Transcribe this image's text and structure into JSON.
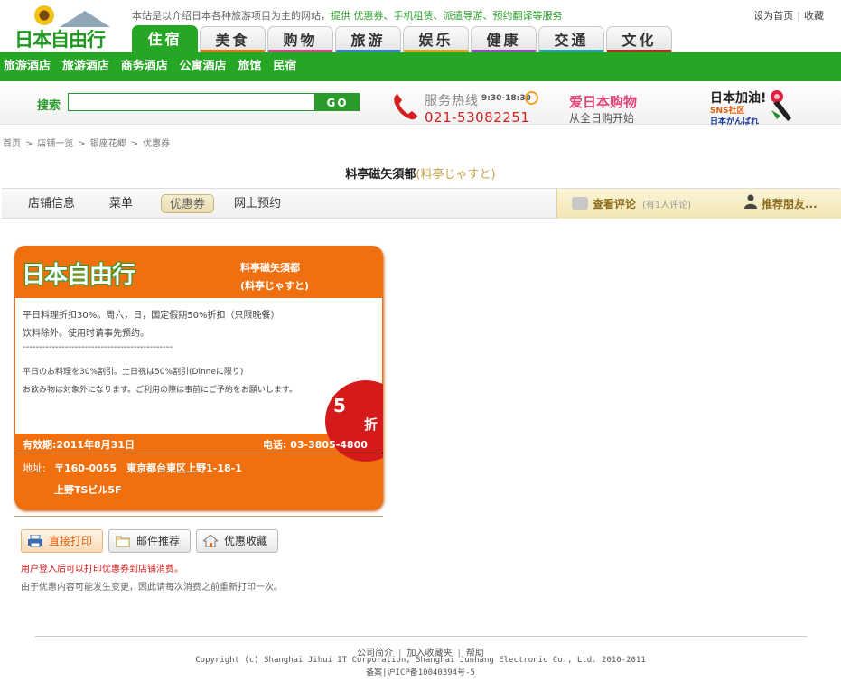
{
  "header": {
    "logo_text": "日本自由行",
    "intro_prefix": "本站是以介绍日本各种旅游项目为主的网站，",
    "intro_highlight": "提供 优惠券、手机租赁、派遣导游、预约翻译等服务",
    "top_links": [
      "设为首页",
      "收藏"
    ]
  },
  "nav": {
    "tabs": [
      {
        "label": "住宿",
        "color": "#25a725"
      },
      {
        "label": "美食",
        "color": "#e5771a"
      },
      {
        "label": "购物",
        "color": "#d04a8a"
      },
      {
        "label": "旅游",
        "color": "#3a7fd0"
      },
      {
        "label": "娱乐",
        "color": "#e0a020"
      },
      {
        "label": "健康",
        "color": "#9a4ac0"
      },
      {
        "label": "交通",
        "color": "#2aa0b0"
      },
      {
        "label": "文化",
        "color": "#b03020"
      }
    ],
    "sub_items": [
      "旅游酒店",
      "旅游酒店",
      "商务酒店",
      "公寓酒店",
      "旅馆",
      "民宿"
    ]
  },
  "search": {
    "label": "搜索",
    "placeholder": "",
    "button": "GO"
  },
  "banners": {
    "hotline_label": "服务热线",
    "hotline_hours": "9:30-18:30",
    "hotline_number": "021-53082251",
    "shop_title": "爱日本购物",
    "shop_sub": "从全日购开始",
    "jp_title": "日本加油!",
    "jp_sns": "SNS社区",
    "jp_sub": "日本がんばれ"
  },
  "breadcrumb": [
    "首页",
    "店铺一览",
    "银座花郷",
    "优惠券"
  ],
  "shop": {
    "name": "料亭磁矢須都",
    "reading": "(料亭じゃすと)"
  },
  "tabs": {
    "items": [
      "店铺信息",
      "菜单",
      "优惠券",
      "网上预约"
    ],
    "review_label": "查看评论",
    "review_count": "(有1人评论)",
    "recommend_label": "推荐朋友..."
  },
  "coupon": {
    "logo": "日本自由行",
    "name": "料亭磁矢須都",
    "reading": "(料亭じゃすと)",
    "lines": [
      "平日料理折扣30%。周六，日，国定假期50%折扣（只限晚餐）",
      "饮料除外。使用时请事先预约。",
      "----------------------------------------------",
      "平日のお料理を30%割引。土日祝は50%割引(Dinneに限り)",
      "お飲み物は対象外になります。ご利用の際は事前にご予約をお願いします。"
    ],
    "discount_number": "5",
    "discount_unit": "折",
    "validity": "有效期:2011年8月31日",
    "phone": "电话: 03-3805-4800",
    "address_label": "地址:",
    "address_line1": "〒160-0055　東京都台東区上野1-18-1",
    "address_line2": "上野TSビル5F"
  },
  "actions": {
    "print": "直接打印",
    "mail": "邮件推荐",
    "favorite": "优惠收藏"
  },
  "notes": {
    "login_note": "用户登入后可以打印优惠券到店铺消费。",
    "change_note": "由于优惠内容可能发生变更，因此请每次消费之前重新打印一次。"
  },
  "footer": {
    "links": [
      "公司简介",
      "加入收藏夹",
      "帮助"
    ],
    "copyright": "Copyright (c) Shanghai Jihui IT Corporation, Shanghai Junhang Electronic Co., Ltd. 2010-2011",
    "icp": "备案|沪ICP备10040394号-5"
  }
}
